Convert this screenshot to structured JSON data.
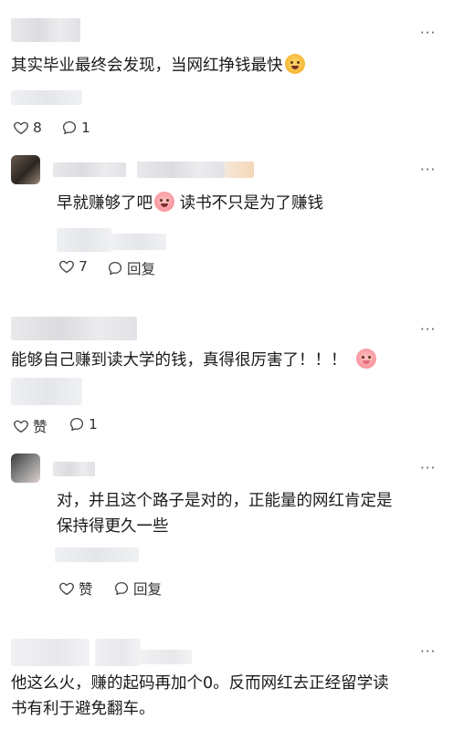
{
  "more_label": "···",
  "comments": [
    {
      "text": "其实毕业最终会发现，当网红挣钱最快",
      "emoji": "laughing-emoji",
      "like_label": "8",
      "comment_label": "1"
    },
    {
      "text": "早就赚够了吧",
      "text_after": " 读书不只是为了赚钱",
      "emoji": "crying-emoji",
      "like_label": "7",
      "comment_label": "回复"
    },
    {
      "text": "能够自己赚到读大学的钱，真得很厉害了！！！",
      "emoji": "pig-emoji",
      "like_label": "赞",
      "comment_label": "1"
    },
    {
      "text_line1": "对，并且这个路子是对的，正能量的网红肯定是",
      "text_line2": "保持得更久一些",
      "like_label": "赞",
      "comment_label": "回复"
    },
    {
      "text_line1": "他这么火，赚的起码再加个0。反而网红去正经留学读",
      "text_line2": "书有利于避免翻车。"
    }
  ],
  "colors": {
    "text": "#1a1a1a",
    "muted": "#333333",
    "background": "#ffffff"
  }
}
